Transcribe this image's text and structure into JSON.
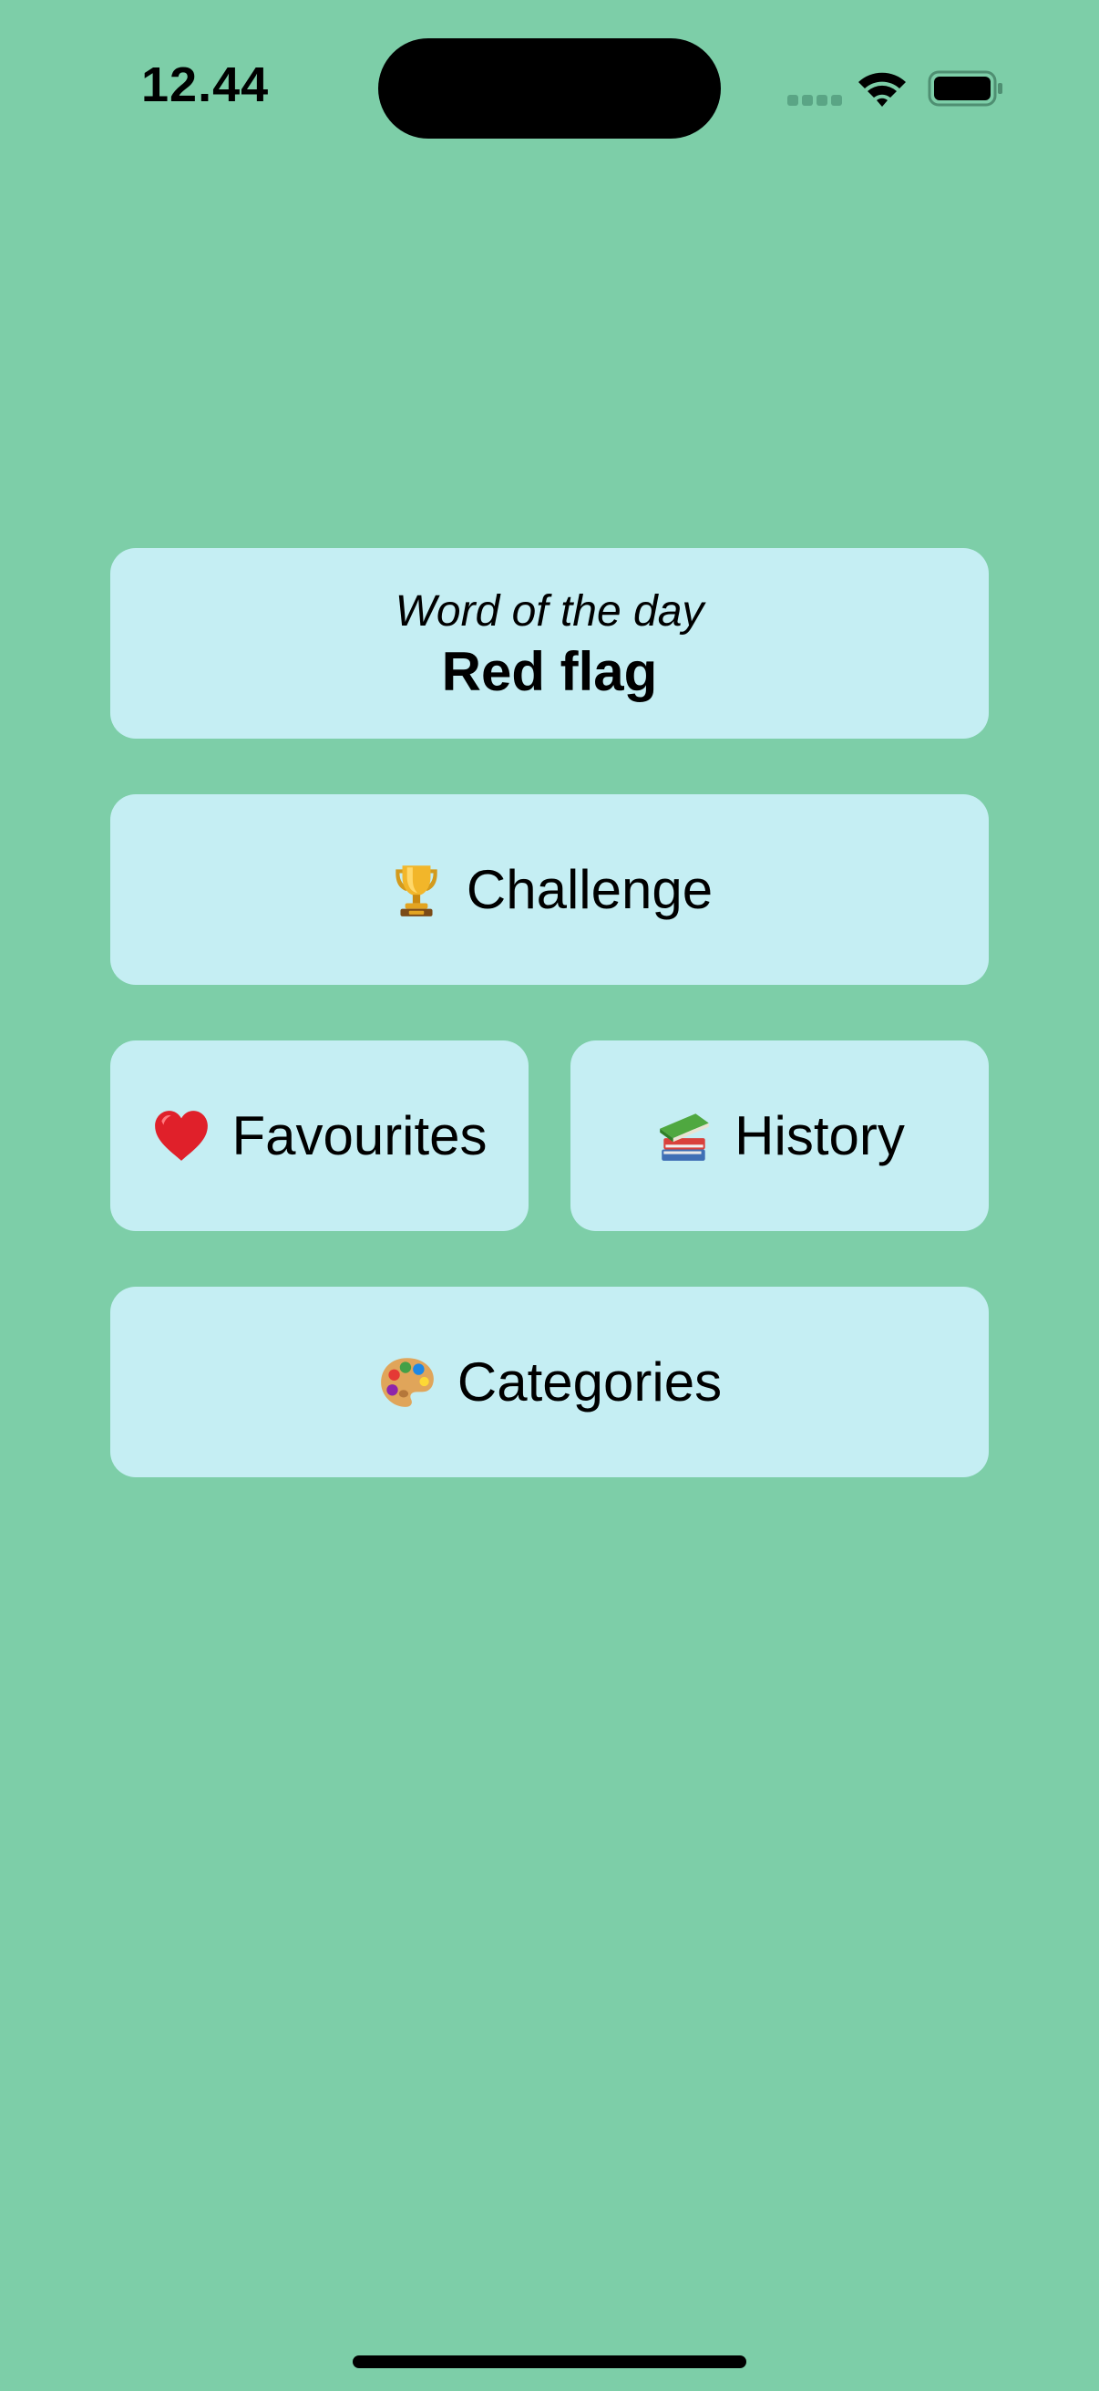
{
  "status_bar": {
    "time": "12.44",
    "icons": [
      "signal-dots-icon",
      "wifi-icon",
      "battery-icon"
    ]
  },
  "word_of_the_day": {
    "label": "Word of the day",
    "word": "Red flag"
  },
  "menu": {
    "challenge": {
      "icon": "trophy-icon",
      "label": "Challenge"
    },
    "favourites": {
      "icon": "heart-icon",
      "label": "Favourites"
    },
    "history": {
      "icon": "books-icon",
      "label": "History"
    },
    "categories": {
      "icon": "palette-icon",
      "label": "Categories"
    }
  },
  "colors": {
    "background": "#7dcea8",
    "card": "#c5eef3",
    "text": "#000000"
  }
}
